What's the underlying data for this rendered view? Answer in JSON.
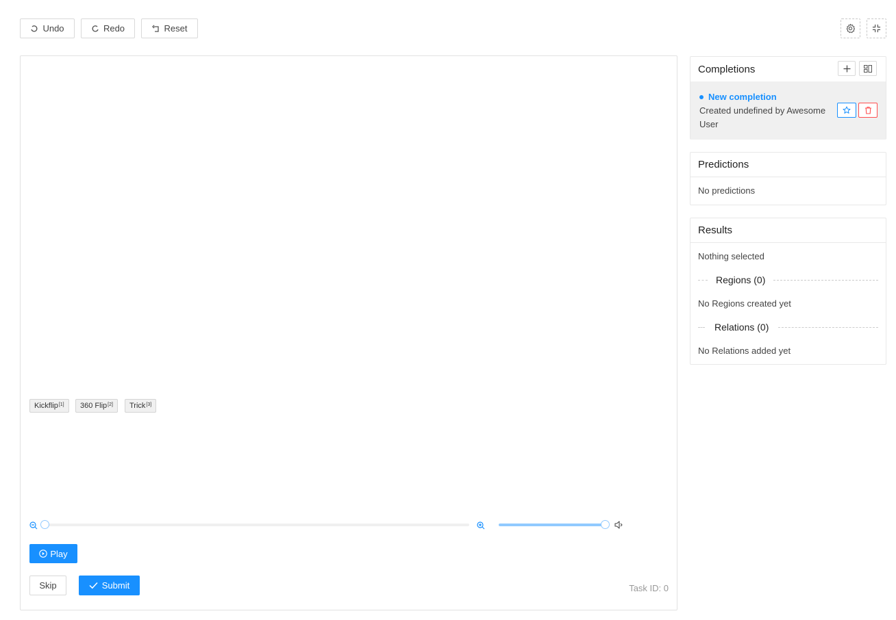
{
  "toolbar": {
    "undo_label": "Undo",
    "redo_label": "Redo",
    "reset_label": "Reset"
  },
  "labels": [
    {
      "name": "Kickflip",
      "hotkey": "[1]"
    },
    {
      "name": "360 Flip",
      "hotkey": "[2]"
    },
    {
      "name": "Trick",
      "hotkey": "[3]"
    }
  ],
  "player": {
    "play_label": "Play",
    "zoom_level": 0,
    "volume_level": 1
  },
  "actions": {
    "skip_label": "Skip",
    "submit_label": "Submit",
    "task_id": "Task ID: 0"
  },
  "completions": {
    "title": "Completions",
    "item_title": "New completion",
    "item_meta": "Created undefined by Awesome User"
  },
  "predictions": {
    "title": "Predictions",
    "empty_text": "No predictions"
  },
  "results": {
    "title": "Results",
    "nothing_selected": "Nothing selected",
    "regions_label": "Regions (0)",
    "regions_empty": "No Regions created yet",
    "relations_label": "Relations (0)",
    "relations_empty": "No Relations added yet"
  },
  "colors": {
    "primary": "#1890ff",
    "danger": "#ff4d4f",
    "selected_bg": "#f0f0f0"
  }
}
